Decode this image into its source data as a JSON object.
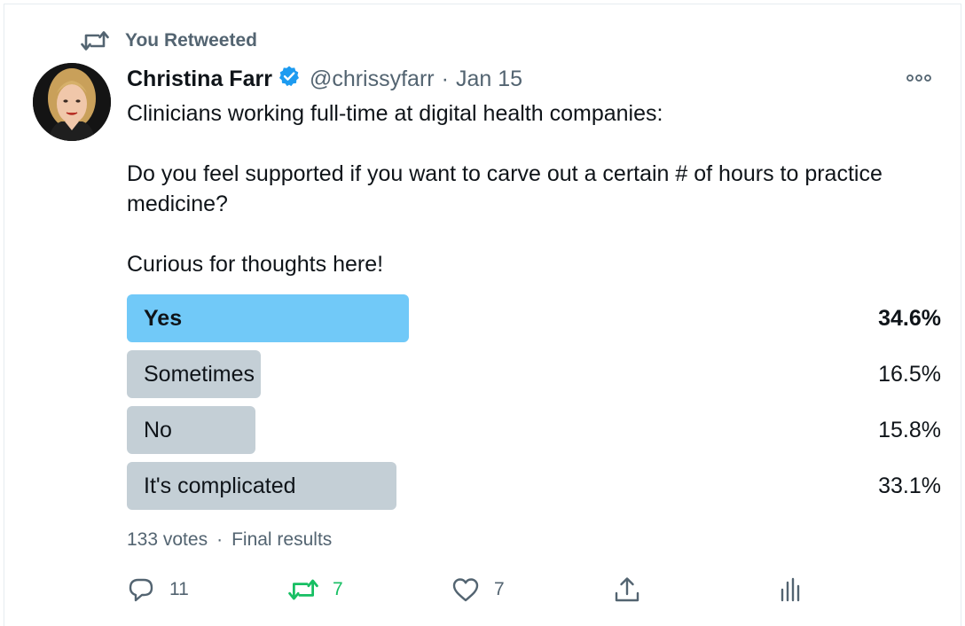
{
  "retweet_context": {
    "label": "You Retweeted",
    "icon": "retweet-icon"
  },
  "author": {
    "name": "Christina Farr",
    "handle": "@chrissyfarr",
    "separator": "·",
    "date": "Jan 15",
    "verified": true,
    "verified_color": "#1d9bf0"
  },
  "tweet": {
    "lines": [
      "Clinicians working full-time at digital health companies:",
      "",
      "Do you feel supported if you want to carve out a certain # of hours to practice medicine?",
      "",
      "Curious for thoughts here!"
    ]
  },
  "poll": {
    "options": [
      {
        "label": "Yes",
        "percent_text": "34.6%",
        "percent": 34.6,
        "winner": true
      },
      {
        "label": "Sometimes",
        "percent_text": "16.5%",
        "percent": 16.5,
        "winner": false
      },
      {
        "label": "No",
        "percent_text": "15.8%",
        "percent": 15.8,
        "winner": false
      },
      {
        "label": "It's complicated",
        "percent_text": "33.1%",
        "percent": 33.1,
        "winner": false
      }
    ],
    "votes": "133 votes",
    "separator": "·",
    "status": "Final results",
    "winner_color": "#71c9f8",
    "bar_color": "#c4cfd6"
  },
  "actions": {
    "reply": {
      "icon": "reply-icon",
      "count": "11"
    },
    "retweet": {
      "icon": "retweet-icon",
      "count": "7",
      "active": true,
      "color": "#17bf63"
    },
    "like": {
      "icon": "heart-icon",
      "count": "7"
    },
    "share": {
      "icon": "share-icon"
    },
    "analytics": {
      "icon": "analytics-icon"
    }
  },
  "colors": {
    "text_primary": "#0f1419",
    "text_secondary": "#536471"
  }
}
